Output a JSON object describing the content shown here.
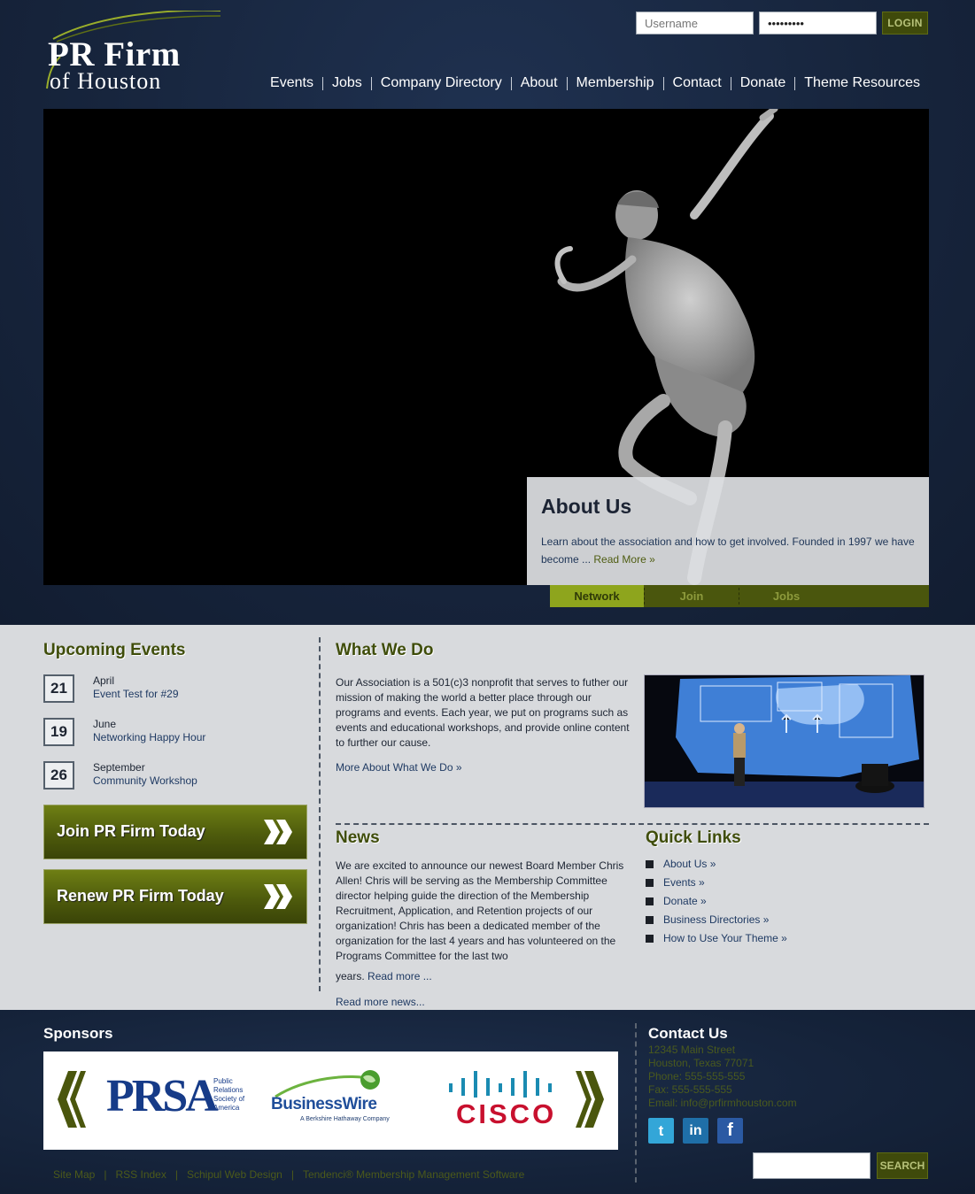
{
  "brand": {
    "line1": "PR Firm",
    "line2": "of Houston"
  },
  "login": {
    "username_placeholder": "Username",
    "password_value": "password1",
    "button": "LOGIN"
  },
  "nav": [
    "Events",
    "Jobs",
    "Company Directory",
    "About",
    "Membership",
    "Contact",
    "Donate",
    "Theme Resources"
  ],
  "hero": {
    "about_title": "About Us",
    "about_text": "Learn about the association and how to get involved. Founded in 1997 we have become ...",
    "about_link": "Read More »",
    "tabs": [
      "Network",
      "Join",
      "Jobs"
    ],
    "active_tab": "Network"
  },
  "events": {
    "title": "Upcoming Events",
    "items": [
      {
        "day": "21",
        "month": "April",
        "name": "Event Test for #29"
      },
      {
        "day": "19",
        "month": "June",
        "name": "Networking Happy Hour"
      },
      {
        "day": "26",
        "month": "September",
        "name": "Community Workshop"
      }
    ]
  },
  "cta": {
    "join": "Join PR Firm Today",
    "renew": "Renew PR Firm Today"
  },
  "what_we_do": {
    "title": "What We Do",
    "text": "Our Association is a 501(c)3 nonprofit that serves to futher our mission of making the world a better place through our programs and events. Each year, we put on programs such as events and educational workshops, and provide online content to further our cause.",
    "link": "More About What We Do »"
  },
  "news": {
    "title": "News",
    "text": "We are excited to announce our newest Board Member Chris Allen! Chris will be serving as the Membership Committee director helping guide the direction of the Membership Recruitment, Application, and Retention projects of our organization! Chris has been a dedicated member of the organization for the last 4 years and has volunteered on the Programs Committee for the last two",
    "last_line": "years.",
    "read_more": "Read more ...",
    "more_news": "Read more news..."
  },
  "quick_links": {
    "title": "Quick Links",
    "items": [
      "About Us »",
      "Events »",
      "Donate »",
      "Business Directories »",
      "How to Use Your Theme »"
    ]
  },
  "footer": {
    "sponsors_title": "Sponsors",
    "sponsors": {
      "prsa": {
        "mark": "PRSA",
        "small": "Public Relations Society of America"
      },
      "businesswire": {
        "name": "BusinessWire",
        "sub": "A Berkshire Hathaway Company"
      },
      "cisco": {
        "name": "CISCO"
      }
    },
    "links": [
      "Site Map",
      "RSS Index",
      "Schipul Web Design",
      "Tendenci® Membership Management Software"
    ],
    "contact": {
      "title": "Contact Us",
      "lines": [
        "12345 Main Street",
        "Houston, Texas 77071",
        "Phone: 555-555-555",
        "Fax: 555-555-555",
        "Email: info@prfirmhouston.com"
      ]
    },
    "social": [
      "twitter-icon",
      "linkedin-icon",
      "facebook-icon"
    ],
    "search_button": "SEARCH"
  },
  "colors": {
    "navy": "#15233a",
    "olive": "#4e5b0c",
    "olive_light": "#8ea51d",
    "panel": "#d8dadd"
  }
}
